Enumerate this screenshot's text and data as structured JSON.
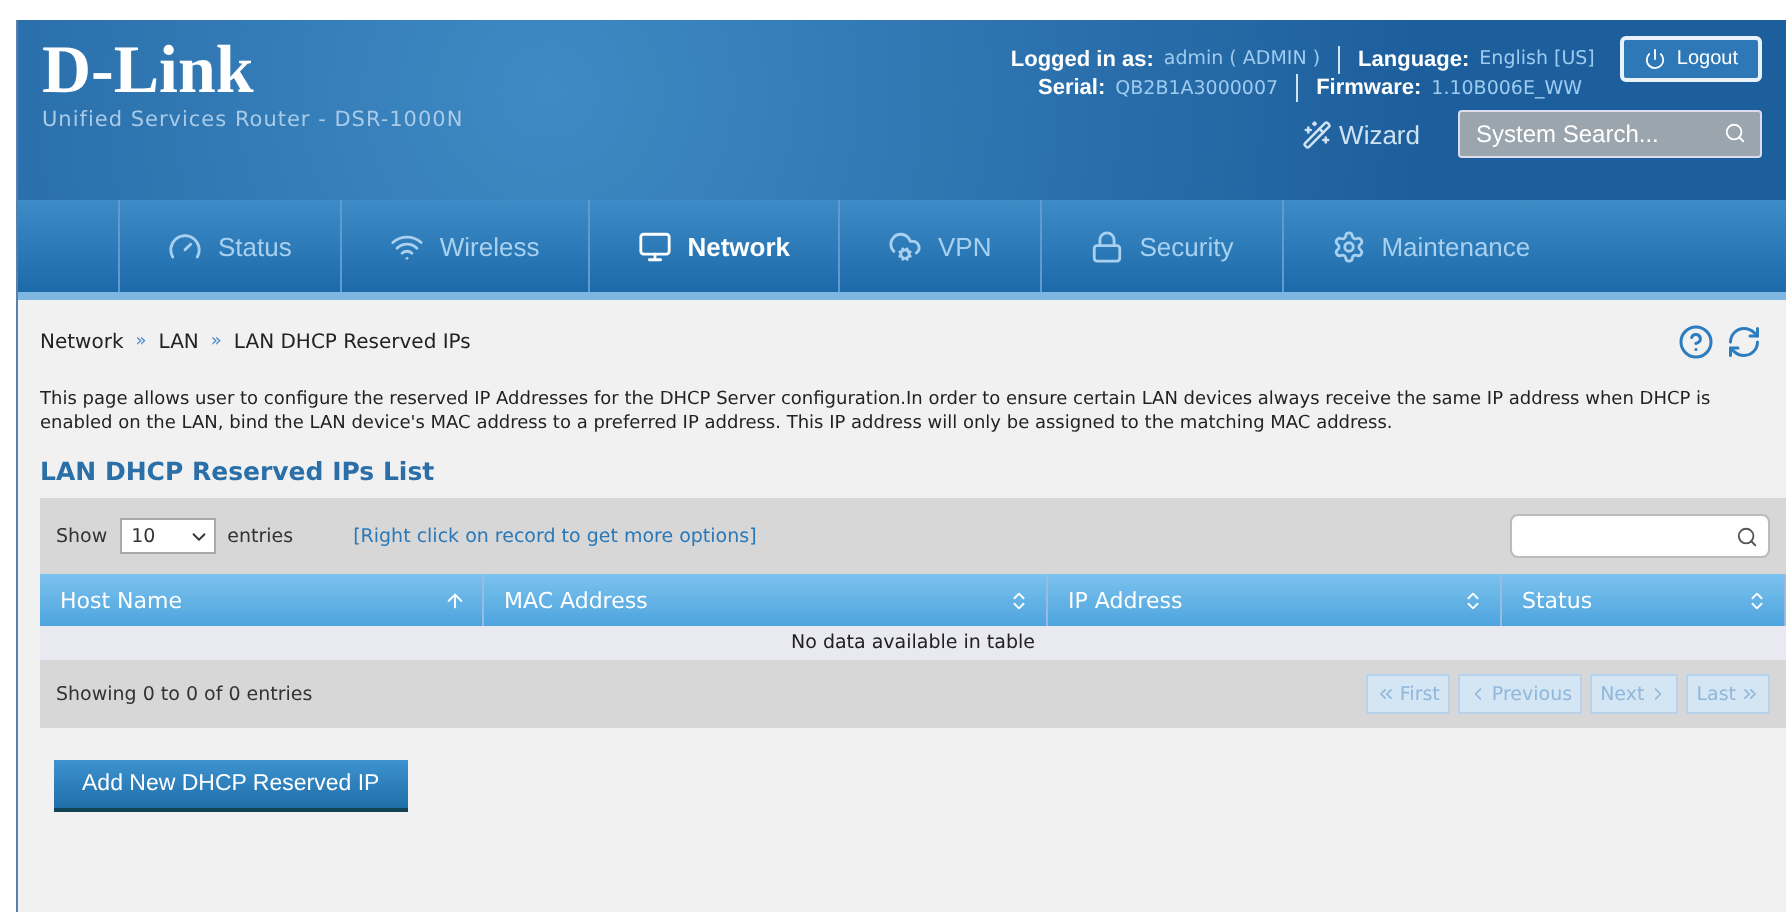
{
  "header": {
    "logo": "D-Link",
    "subtitle": "Unified Services Router - DSR-1000N",
    "logged_in_label": "Logged in as:",
    "user": "admin ( ADMIN )",
    "language_label": "Language:",
    "language": "English [US]",
    "serial_label": "Serial:",
    "serial": "QB2B1A3000007",
    "firmware_label": "Firmware:",
    "firmware": "1.10B006E_WW",
    "logout": "Logout",
    "wizard": "Wizard",
    "search": {
      "placeholder": "System Search..."
    }
  },
  "nav": [
    {
      "label": "Status",
      "selected": false
    },
    {
      "label": "Wireless",
      "selected": false
    },
    {
      "label": "Network",
      "selected": true
    },
    {
      "label": "VPN",
      "selected": false
    },
    {
      "label": "Security",
      "selected": false
    },
    {
      "label": "Maintenance",
      "selected": false
    }
  ],
  "breadcrumb": [
    "Network",
    "LAN",
    "LAN DHCP Reserved IPs"
  ],
  "breadcrumb_separator": "»",
  "description": "This page allows user to configure the reserved IP Addresses for the DHCP Server configuration.In order to ensure certain LAN devices always receive the same IP address when DHCP is enabled on the LAN, bind the LAN device's MAC address to a preferred IP address. This IP address will only be assigned to the matching MAC address.",
  "section_title": "LAN DHCP Reserved IPs List",
  "table": {
    "show_label": "Show",
    "page_size": "10",
    "entries_label": "entries",
    "hint": "[Right click on record to get more options]",
    "columns": [
      {
        "label": "Host Name",
        "kind": "sorted"
      },
      {
        "label": "MAC Address",
        "kind": "sortable"
      },
      {
        "label": "IP Address",
        "kind": "sortable"
      },
      {
        "label": "Status",
        "kind": "sortable"
      }
    ],
    "empty_message": "No data available in table",
    "info": "Showing 0 to 0 of 0 entries",
    "pager": [
      {
        "label": "First",
        "kind": "first",
        "disabled": true
      },
      {
        "label": "Previous",
        "kind": "prev",
        "disabled": true
      },
      {
        "label": "Next",
        "kind": "next",
        "disabled": true
      },
      {
        "label": "Last",
        "kind": "last",
        "disabled": true
      }
    ]
  },
  "add_button": "Add New DHCP Reserved IP"
}
